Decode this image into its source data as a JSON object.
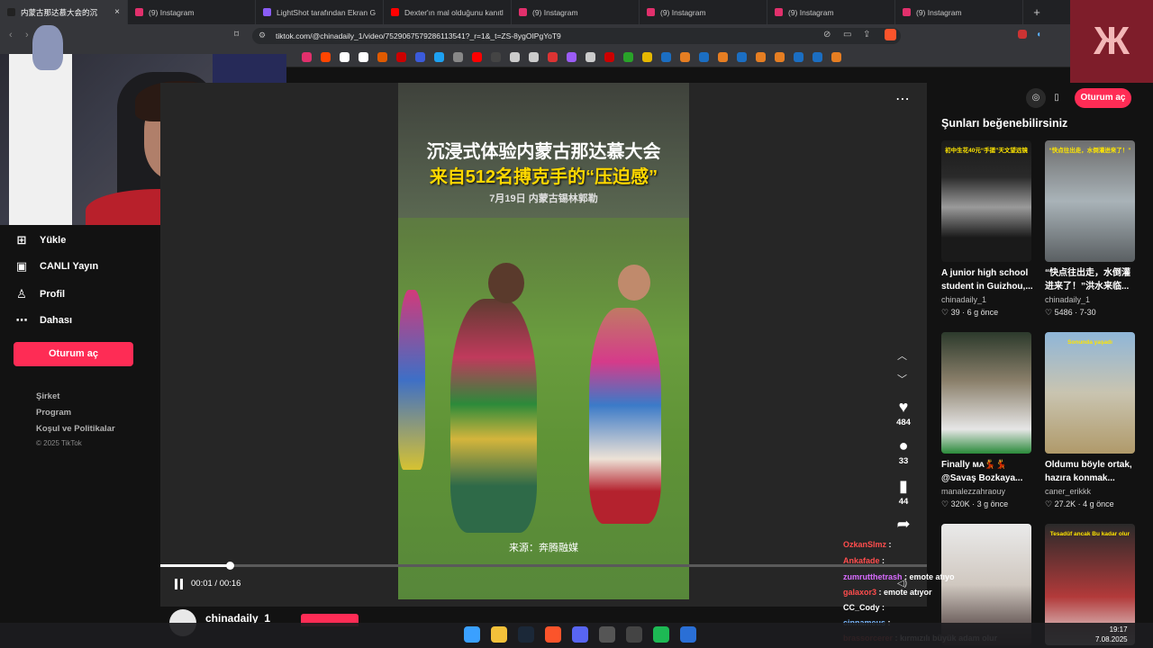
{
  "tabs": [
    {
      "label": "内蒙古那达慕大会的沉",
      "active": true,
      "color": "#222222"
    },
    {
      "label": "(9) Instagram",
      "color": "#e1306c"
    },
    {
      "label": "LightShot tarafından Ekran Görü",
      "color": "#8a5cf6"
    },
    {
      "label": "Dexter'ın mal olduğunu kanıtlı",
      "color": "#ff0000"
    },
    {
      "label": "(9) Instagram",
      "color": "#e1306c"
    },
    {
      "label": "(9) Instagram",
      "color": "#e1306c"
    },
    {
      "label": "(9) Instagram",
      "color": "#e1306c"
    },
    {
      "label": "(9) Instagram",
      "color": "#e1306c"
    }
  ],
  "address": {
    "url": "tiktok.com/@chinadaily_1/video/7529067579286113541?_r=1&_t=ZS-8ygOIPgYoT9"
  },
  "nav": [
    {
      "label": "Yükle",
      "icon": "plus-square-icon"
    },
    {
      "label": "CANLI Yayın",
      "icon": "live-icon"
    },
    {
      "label": "Profil",
      "icon": "person-icon"
    },
    {
      "label": "Dahası",
      "icon": "more-icon"
    }
  ],
  "login_label": "Oturum aç",
  "footer": {
    "company": "Şirket",
    "program": "Program",
    "terms": "Koşul ve Politikalar",
    "copyright": "© 2025 TikTok"
  },
  "video": {
    "title_line1": "沉浸式体验内蒙古那达慕大会",
    "title_line2": "来自512名搏克手的“压迫感”",
    "date_line": "7月19日  内蒙古锡林郭勒",
    "source": "来源：奔腾融媒",
    "time": "00:01 / 00:16",
    "progress": 0.09,
    "likes": "484",
    "comments": "33",
    "saves": "44",
    "author": "chinadaily_1"
  },
  "right": {
    "title": "Şunları beğenebilirsiniz",
    "cards": [
      {
        "title": "A junior high school student in Guizhou,...",
        "user": "chinadaily_1",
        "likes": "39",
        "ago": "6 g önce",
        "thumb_label": "初中生花40元“手搓”天文望远镜"
      },
      {
        "title": "“快点往出走，水倒灌进来了！”洪水来临...",
        "user": "chinadaily_1",
        "likes": "5486",
        "ago": "7-30",
        "thumb_label": "“快点往出走，水倒灌进来了！”"
      },
      {
        "title": "Finally ᴍᴀ💃💃 @Savaş Bozkaya...",
        "user": "manalezzahraouy",
        "likes": "320K",
        "ago": "3 g önce",
        "thumb_label": ""
      },
      {
        "title": "Oldumu böyle ortak, hazıra konmak...",
        "user": "caner_erikkk",
        "likes": "27.2K",
        "ago": "4 g önce",
        "thumb_label": "Sonunda yaşadı"
      },
      {
        "title": "",
        "user": "",
        "likes": "",
        "ago": "",
        "thumb_label": ""
      },
      {
        "title": "",
        "user": "",
        "likes": "",
        "ago": "",
        "thumb_label": "Tesadüf ancak Bu kadar olur"
      }
    ]
  },
  "chat": [
    {
      "user": "OzkanSlmz",
      "msg": "",
      "color": "#ff4d4d"
    },
    {
      "user": "Ankafade",
      "msg": "",
      "color": "#ff4d4d"
    },
    {
      "user": "zumrutthetrash",
      "msg": "emote atıyo",
      "color": "#d86bff"
    },
    {
      "user": "galaxor3",
      "msg": "emote atıyor",
      "color": "#ff4d4d"
    },
    {
      "user": "CC_Cody",
      "msg": "",
      "color": "#ffffff"
    },
    {
      "user": "cinnameus",
      "msg": "",
      "color": "#7ab8ff"
    },
    {
      "user": "brassorcerer",
      "msg": "kırmızılı büyük adam olur",
      "color": "#ff4d4d"
    }
  ],
  "clock": {
    "time": "19:17",
    "date": "7.08.2025"
  }
}
